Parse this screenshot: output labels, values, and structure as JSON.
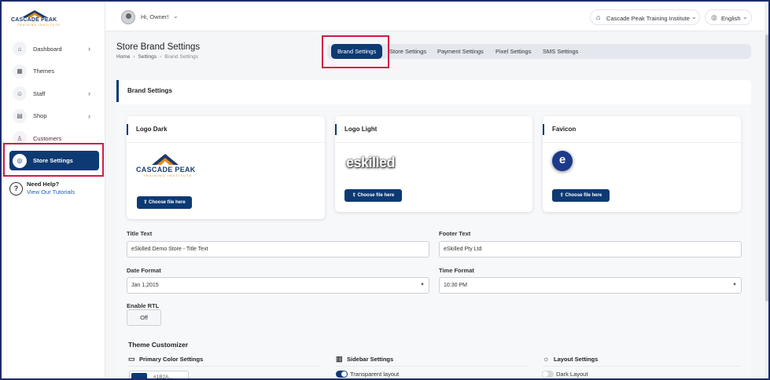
{
  "brand": {
    "logo_title": "CASCADE PEAK",
    "logo_sub": "TRAINING INSTITUTE",
    "color_primary": "#0d3a73",
    "color_accent": "#e08a1e"
  },
  "sidebar": {
    "items": [
      {
        "label": "Dashboard",
        "icon": "home-icon",
        "has_chevron": true
      },
      {
        "label": "Themes",
        "icon": "themes-icon",
        "has_chevron": false
      },
      {
        "label": "Staff",
        "icon": "staff-icon",
        "has_chevron": true
      },
      {
        "label": "Shop",
        "icon": "shop-icon",
        "has_chevron": true
      },
      {
        "label": "Customers",
        "icon": "customer-icon",
        "has_chevron": false
      },
      {
        "label": "Store Settings",
        "icon": "settings-icon",
        "has_chevron": false,
        "active": true
      }
    ],
    "help_title": "Need Help?",
    "help_link": "View Our Tutorials"
  },
  "topbar": {
    "greeting": "Hi, Owner!",
    "institute": "Cascade Peak Training Institute",
    "language": "English"
  },
  "page": {
    "title": "Store Brand Settings",
    "breadcrumb": [
      "Home",
      "Settings",
      "Brand Settings"
    ]
  },
  "tabs": [
    {
      "label": "Brand Settings",
      "active": true
    },
    {
      "label": "Store Settings"
    },
    {
      "label": "Payment Settings"
    },
    {
      "label": "Pixel Settings"
    },
    {
      "label": "SMS Settings"
    }
  ],
  "section": {
    "title": "Brand Settings"
  },
  "uploads": [
    {
      "title": "Logo Dark",
      "button": "Choose file here"
    },
    {
      "title": "Logo Light",
      "button": "Choose file here",
      "preview_text": "eskilled"
    },
    {
      "title": "Favicon",
      "button": "Choose file here",
      "preview_text": "e"
    }
  ],
  "form": {
    "title_text_label": "Title Text",
    "title_text_value": "eSkilled Demo Store - Title Text",
    "footer_text_label": "Footer Text",
    "footer_text_value": "eSkilled Pty Ltd",
    "date_format_label": "Date Format",
    "date_format_value": "Jan 1,2015",
    "time_format_label": "Time Format",
    "time_format_value": "10:30 PM",
    "rtl_label": "Enable RTL",
    "rtl_value": "Off"
  },
  "theme": {
    "title": "Theme Customizer",
    "primary_color_label": "Primary Color Settings",
    "primary_color_value": "#0d3a73",
    "primary_color_text": "#1B2A..",
    "sidebar_label": "Sidebar Settings",
    "transparent_label": "Transparent layout",
    "transparent_on": true,
    "layout_label": "Layout Settings",
    "dark_label": "Dark Layout",
    "dark_on": false
  }
}
